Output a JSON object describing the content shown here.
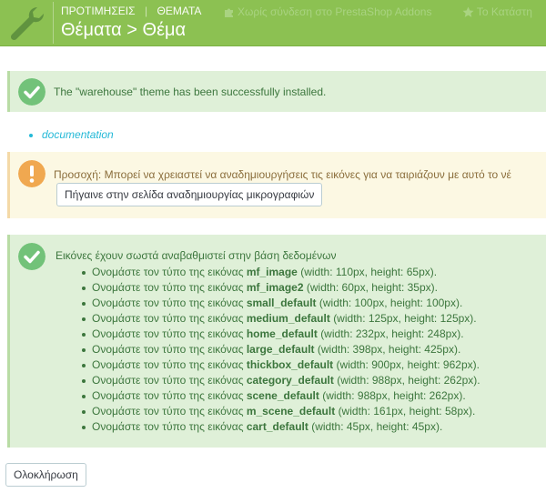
{
  "header": {
    "breadcrumb": [
      "ΠΡΟΤΙΜΗΣΕΙΣ",
      "ΘΕΜΑΤΑ"
    ],
    "title": "Θέματα > Θέμα",
    "toolbar": [
      {
        "label": "Χωρίς σύνδεση στο PrestaShop Addons",
        "icon": "puzzle-icon"
      },
      {
        "label": "Το Κατάστη",
        "icon": "star-icon"
      }
    ],
    "colors": {
      "bar": "#8cc152"
    }
  },
  "success_alert": {
    "message": "The \"warehouse\" theme has been successfully installed.",
    "icon": "check-circle-icon"
  },
  "documentation_link": "documentation",
  "warning_alert": {
    "message": "Προσοχή: Μπορεί να χρειαστεί να αναδημιουργήσεις τις εικόνες για να ταιριάζουν με αυτό το νέ",
    "button_label": "Πήγαινε στην σελίδα αναδημιουργίας μικρογραφιών",
    "icon": "exclamation-circle-icon"
  },
  "images_alert": {
    "message": "Εικόνες έχουν σωστά αναβαθμιστεί στην βάση δεδομένων",
    "icon": "check-circle-icon",
    "prefix": "Ονομάστε τον τύπο της εικόνας",
    "items": [
      {
        "name": "mf_image",
        "detail": "(width: 110px, height: 65px)."
      },
      {
        "name": "mf_image2",
        "detail": "(width: 60px, height: 35px)."
      },
      {
        "name": "small_default",
        "detail": "(width: 100px, height: 100px)."
      },
      {
        "name": "medium_default",
        "detail": "(width: 125px, height: 125px)."
      },
      {
        "name": "home_default",
        "detail": "(width: 232px, height: 248px)."
      },
      {
        "name": "large_default",
        "detail": "(width: 398px, height: 425px)."
      },
      {
        "name": "thickbox_default",
        "detail": "(width: 900px, height: 962px)."
      },
      {
        "name": "category_default",
        "detail": "(width: 988px, height: 262px)."
      },
      {
        "name": "scene_default",
        "detail": "(width: 988px, height: 262px)."
      },
      {
        "name": "m_scene_default",
        "detail": "(width: 161px, height: 58px)."
      },
      {
        "name": "cart_default",
        "detail": "(width: 45px, height: 45px)."
      }
    ]
  },
  "finish_button": "Ολοκλήρωση"
}
